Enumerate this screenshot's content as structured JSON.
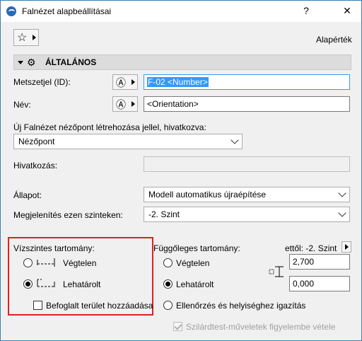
{
  "window": {
    "title": "Falnézet alapbeállításai",
    "help": "?",
    "close": "✕"
  },
  "top": {
    "favorites_icon": "star-icon",
    "default_label": "Alapérték"
  },
  "section": {
    "label": "ÁLTALÁNOS"
  },
  "fields": {
    "id_label": "Metszetjel (ID):",
    "id_value": "F-02 <Number>",
    "name_label": "Név:",
    "name_value": "<Orientation>",
    "create_label": "Új Falnézet nézőpont létrehozása jellel, hivatkozva:",
    "create_value": "Nézőpont",
    "ref_label": "Hivatkozás:",
    "ref_value": "",
    "status_label": "Állapot:",
    "status_value": "Modell automatikus újraépítése",
    "show_label": "Megjelenítés ezen szinteken:",
    "show_value": "-2. Szint"
  },
  "horizontal": {
    "title": "Vízszintes tartomány:",
    "infinite": "Végtelen",
    "limited": "Lehatárolt",
    "selected": "limited",
    "add_area": "Befoglalt terület hozzáadása",
    "add_area_checked": false
  },
  "vertical": {
    "title": "Függőleges tartomány:",
    "from_label": "ettől: -2. Szint",
    "infinite": "Végtelen",
    "limited": "Lehatárolt",
    "selected": "limited",
    "top_value": "2,700",
    "bottom_value": "0,000",
    "adjust": "Ellenőrzés és helyiséghez igazítás",
    "solid_ops": "Szilárdtest-műveletek figyelembe vétele",
    "solid_ops_checked": true
  }
}
